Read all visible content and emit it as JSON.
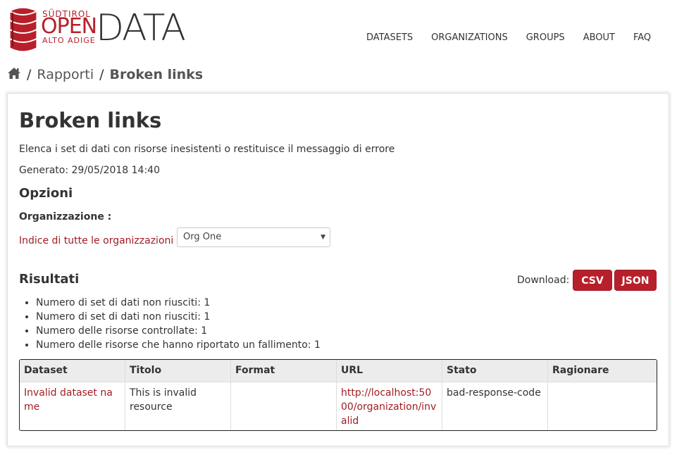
{
  "brand": {
    "logo_top_text": "SÜDTIROL",
    "logo_open_text": "OPEN",
    "logo_bottom_text": "ALTO ADIGE",
    "logo_data_text": "DATA",
    "accent_color": "#b7202b"
  },
  "nav": {
    "items": [
      "DATASETS",
      "ORGANIZATIONS",
      "GROUPS",
      "ABOUT",
      "FAQ"
    ]
  },
  "breadcrumb": {
    "home_icon": "home-icon",
    "separator": "/",
    "items": [
      "Rapporti",
      "Broken links"
    ]
  },
  "report": {
    "title": "Broken links",
    "description": "Elenca i set di dati con risorse inesistenti o restituisce il messaggio di errore",
    "generated": "Generato: 29/05/2018 14:40",
    "options_heading": "Opzioni",
    "organization_label": "Organizzazione :",
    "organization_index_link": "Indice di tutte le organizzazioni",
    "organization_selected": "Org One",
    "results_heading": "Risultati",
    "download_label": "Download:",
    "download_buttons": [
      "CSV",
      "JSON"
    ],
    "summary": [
      "Numero di set di dati non riusciti: 1",
      "Numero di set di dati non riusciti: 1",
      "Numero delle risorse controllate: 1",
      "Numero delle risorse che hanno riportato un fallimento: 1"
    ]
  },
  "table": {
    "columns": [
      "Dataset",
      "Titolo",
      "Format",
      "URL",
      "Stato",
      "Ragionare"
    ],
    "rows": [
      {
        "dataset": "Invalid dataset name",
        "title": "This is invalid resource",
        "format": "",
        "url": "http://localhost:5000/organization/invalid",
        "status": "bad-response-code",
        "reason": ""
      }
    ]
  }
}
